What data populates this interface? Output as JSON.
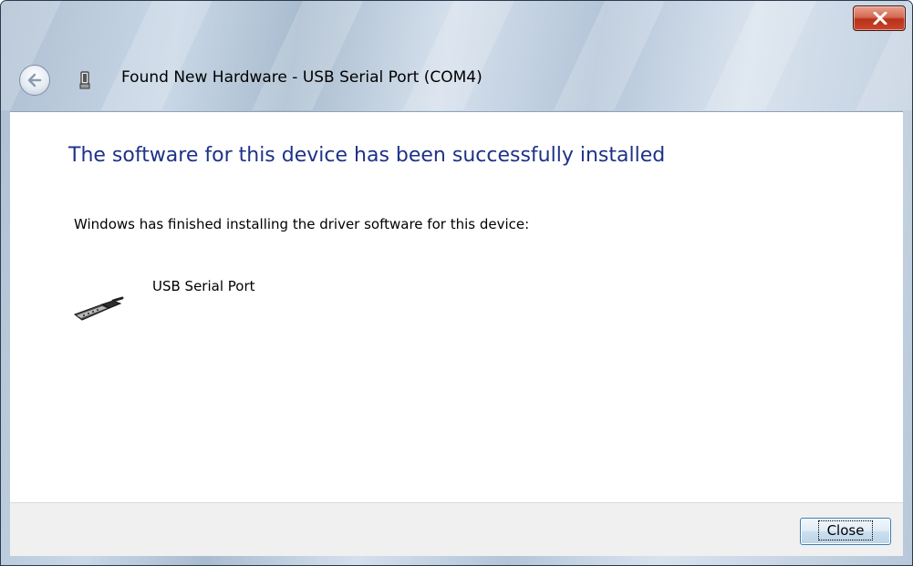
{
  "window": {
    "title": "Found New Hardware - USB Serial Port (COM4)",
    "close_glyph": "x"
  },
  "content": {
    "heading": "The software for this device has been successfully installed",
    "message": "Windows has finished installing the driver software for this device:",
    "device_name": "USB Serial Port",
    "device_icon": "serial-connector-icon"
  },
  "footer": {
    "close_label": "Close"
  },
  "colors": {
    "heading": "#1e3287",
    "close_button_border": "#3c7fb1",
    "window_close": "#c9452c"
  }
}
